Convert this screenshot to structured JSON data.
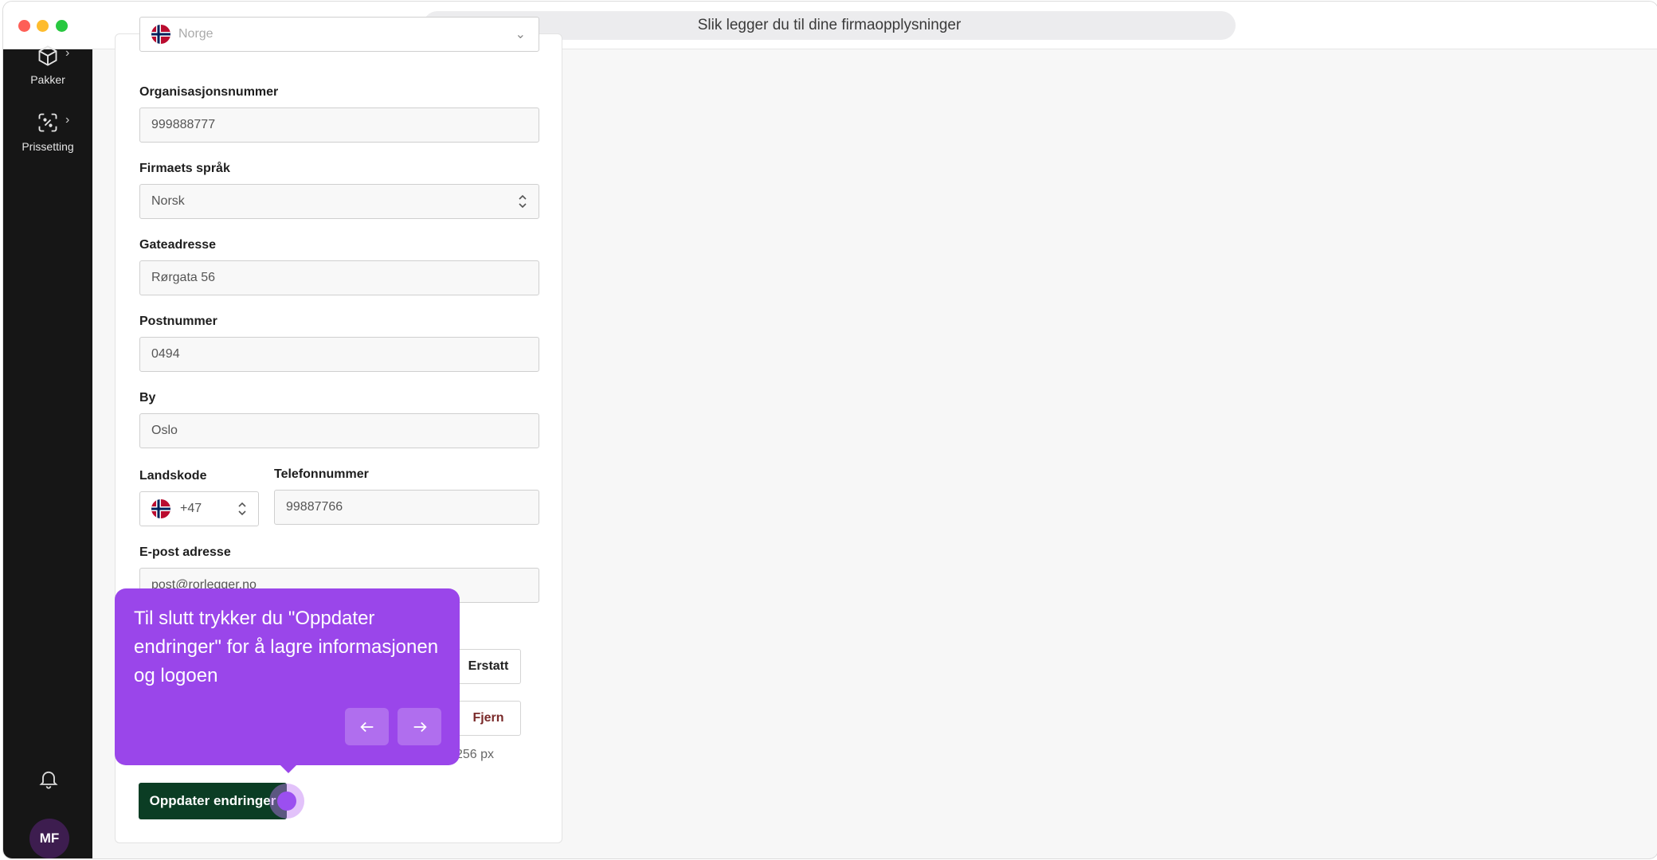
{
  "window": {
    "title": "Slik legger du til dine firmaopplysninger"
  },
  "sidebar": {
    "items": [
      {
        "label": "Pakker",
        "icon": "box-icon"
      },
      {
        "label": "Prissetting",
        "icon": "pricing-icon"
      }
    ],
    "avatar_initials": "MF"
  },
  "form": {
    "country": {
      "value": "Norge"
    },
    "org_number": {
      "label": "Organisasjonsnummer",
      "value": "999888777"
    },
    "language": {
      "label": "Firmaets språk",
      "value": "Norsk"
    },
    "street": {
      "label": "Gateadresse",
      "value": "Rørgata 56"
    },
    "postal": {
      "label": "Postnummer",
      "value": "0494"
    },
    "city": {
      "label": "By",
      "value": "Oslo"
    },
    "country_code": {
      "label": "Landskode",
      "value": "+47"
    },
    "phone": {
      "label": "Telefonnummer",
      "value": "99887766"
    },
    "email": {
      "label": "E-post adresse",
      "value": "post@rorlegger.no"
    },
    "logo": {
      "replace_label": "Erstatt",
      "remove_label": "Fjern",
      "size_hint": "256 px"
    },
    "submit_label": "Oppdater endringer"
  },
  "tooltip": {
    "text": "Til slutt trykker du \"Oppdater endringer\" for å lagre informasjonen og logoen"
  },
  "colors": {
    "sidebar": "#161616",
    "primary": "#0b3d24",
    "tooltip": "#9a46ea",
    "danger_text": "#7a2a2a"
  }
}
